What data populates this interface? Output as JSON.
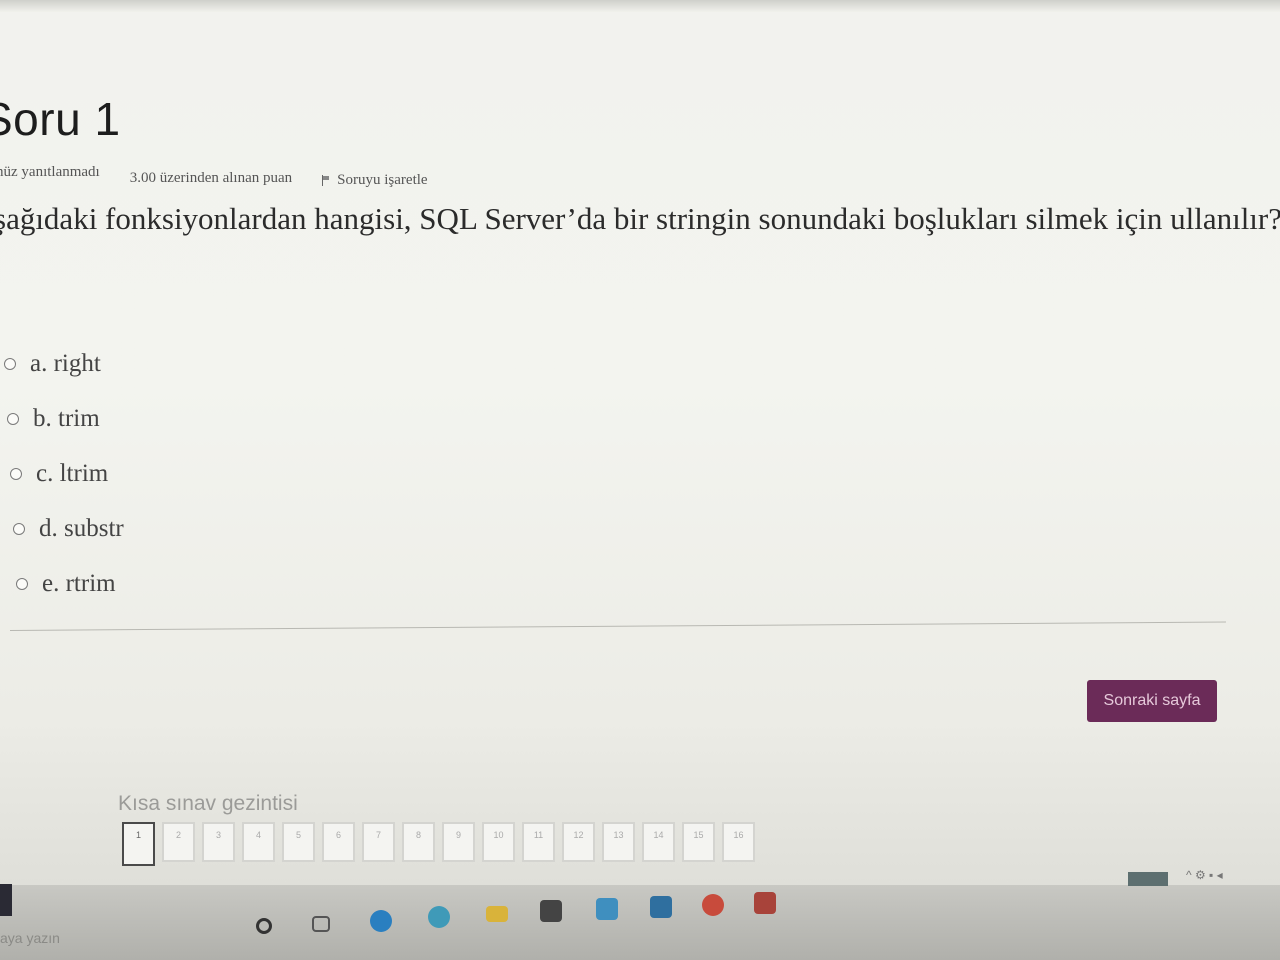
{
  "question": {
    "title": "Soru 1",
    "status": "nüz yanıtlanmadı",
    "score": "3.00 üzerinden alınan puan",
    "flag_label": "Soruyu işaretle",
    "text": "şağıdaki fonksiyonlardan hangisi, SQL Server’da bir stringin sonundaki boşlukları silmek için ullanılır?",
    "answers": [
      {
        "label": "a. right"
      },
      {
        "label": "b. trim"
      },
      {
        "label": "c. ltrim"
      },
      {
        "label": "d. substr"
      },
      {
        "label": "e. rtrim"
      }
    ]
  },
  "next_button": "Sonraki sayfa",
  "navigation": {
    "title": "Kısa sınav gezintisi",
    "buttons": [
      "1",
      "2",
      "3",
      "4",
      "5",
      "6",
      "7",
      "8",
      "9",
      "10",
      "11",
      "12",
      "13",
      "14",
      "15",
      "16"
    ]
  },
  "taskbar": {
    "search_text": "aya yazın"
  },
  "colors": {
    "accent": "#6b2b58"
  }
}
